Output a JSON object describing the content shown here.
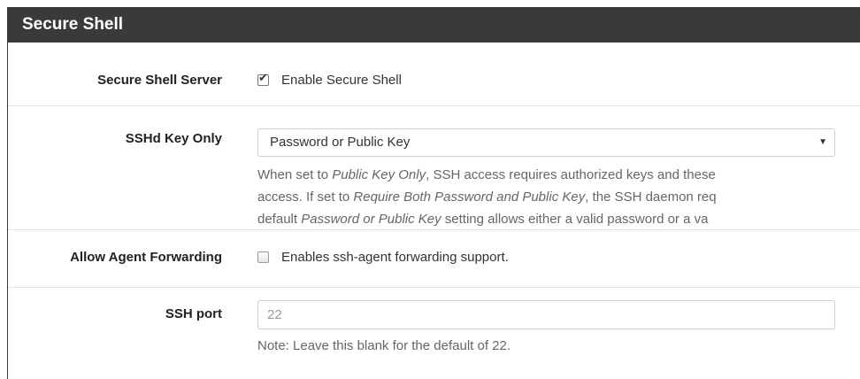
{
  "panel": {
    "title": "Secure Shell"
  },
  "ssh_server": {
    "label": "Secure Shell Server",
    "checkbox_label": "Enable Secure Shell",
    "checked": true
  },
  "key_only": {
    "label": "SSHd Key Only",
    "selected": "Password or Public Key",
    "help": {
      "l1a": "When set to ",
      "l1b": "Public Key Only",
      "l1c": ", SSH access requires authorized keys and these",
      "l2a": "access. If set to ",
      "l2b": "Require Both Password and Public Key",
      "l2c": ", the SSH daemon req",
      "l3a": "default ",
      "l3b": "Password or Public Key",
      "l3c": " setting allows either a valid password or a va"
    }
  },
  "agent_forwarding": {
    "label": "Allow Agent Forwarding",
    "checkbox_label": "Enables ssh-agent forwarding support.",
    "checked": false
  },
  "ssh_port": {
    "label": "SSH port",
    "placeholder": "22",
    "note": "Note: Leave this blank for the default of 22."
  }
}
